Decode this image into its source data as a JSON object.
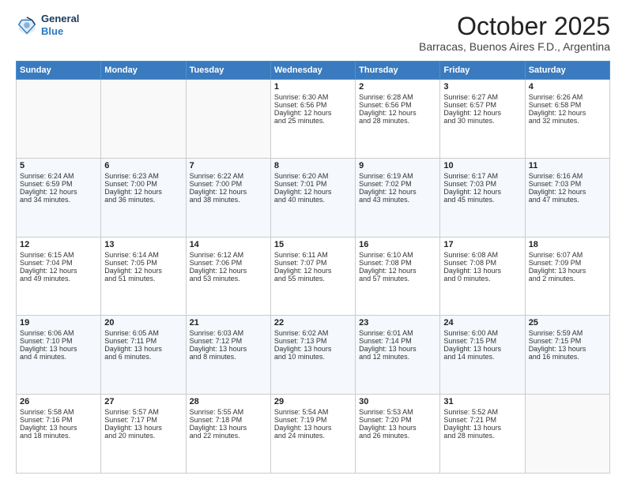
{
  "header": {
    "logo_line1": "General",
    "logo_line2": "Blue",
    "month": "October 2025",
    "location": "Barracas, Buenos Aires F.D., Argentina"
  },
  "days_of_week": [
    "Sunday",
    "Monday",
    "Tuesday",
    "Wednesday",
    "Thursday",
    "Friday",
    "Saturday"
  ],
  "weeks": [
    [
      {
        "day": "",
        "info": ""
      },
      {
        "day": "",
        "info": ""
      },
      {
        "day": "",
        "info": ""
      },
      {
        "day": "1",
        "info": "Sunrise: 6:30 AM\nSunset: 6:56 PM\nDaylight: 12 hours\nand 25 minutes."
      },
      {
        "day": "2",
        "info": "Sunrise: 6:28 AM\nSunset: 6:56 PM\nDaylight: 12 hours\nand 28 minutes."
      },
      {
        "day": "3",
        "info": "Sunrise: 6:27 AM\nSunset: 6:57 PM\nDaylight: 12 hours\nand 30 minutes."
      },
      {
        "day": "4",
        "info": "Sunrise: 6:26 AM\nSunset: 6:58 PM\nDaylight: 12 hours\nand 32 minutes."
      }
    ],
    [
      {
        "day": "5",
        "info": "Sunrise: 6:24 AM\nSunset: 6:59 PM\nDaylight: 12 hours\nand 34 minutes."
      },
      {
        "day": "6",
        "info": "Sunrise: 6:23 AM\nSunset: 7:00 PM\nDaylight: 12 hours\nand 36 minutes."
      },
      {
        "day": "7",
        "info": "Sunrise: 6:22 AM\nSunset: 7:00 PM\nDaylight: 12 hours\nand 38 minutes."
      },
      {
        "day": "8",
        "info": "Sunrise: 6:20 AM\nSunset: 7:01 PM\nDaylight: 12 hours\nand 40 minutes."
      },
      {
        "day": "9",
        "info": "Sunrise: 6:19 AM\nSunset: 7:02 PM\nDaylight: 12 hours\nand 43 minutes."
      },
      {
        "day": "10",
        "info": "Sunrise: 6:17 AM\nSunset: 7:03 PM\nDaylight: 12 hours\nand 45 minutes."
      },
      {
        "day": "11",
        "info": "Sunrise: 6:16 AM\nSunset: 7:03 PM\nDaylight: 12 hours\nand 47 minutes."
      }
    ],
    [
      {
        "day": "12",
        "info": "Sunrise: 6:15 AM\nSunset: 7:04 PM\nDaylight: 12 hours\nand 49 minutes."
      },
      {
        "day": "13",
        "info": "Sunrise: 6:14 AM\nSunset: 7:05 PM\nDaylight: 12 hours\nand 51 minutes."
      },
      {
        "day": "14",
        "info": "Sunrise: 6:12 AM\nSunset: 7:06 PM\nDaylight: 12 hours\nand 53 minutes."
      },
      {
        "day": "15",
        "info": "Sunrise: 6:11 AM\nSunset: 7:07 PM\nDaylight: 12 hours\nand 55 minutes."
      },
      {
        "day": "16",
        "info": "Sunrise: 6:10 AM\nSunset: 7:08 PM\nDaylight: 12 hours\nand 57 minutes."
      },
      {
        "day": "17",
        "info": "Sunrise: 6:08 AM\nSunset: 7:08 PM\nDaylight: 13 hours\nand 0 minutes."
      },
      {
        "day": "18",
        "info": "Sunrise: 6:07 AM\nSunset: 7:09 PM\nDaylight: 13 hours\nand 2 minutes."
      }
    ],
    [
      {
        "day": "19",
        "info": "Sunrise: 6:06 AM\nSunset: 7:10 PM\nDaylight: 13 hours\nand 4 minutes."
      },
      {
        "day": "20",
        "info": "Sunrise: 6:05 AM\nSunset: 7:11 PM\nDaylight: 13 hours\nand 6 minutes."
      },
      {
        "day": "21",
        "info": "Sunrise: 6:03 AM\nSunset: 7:12 PM\nDaylight: 13 hours\nand 8 minutes."
      },
      {
        "day": "22",
        "info": "Sunrise: 6:02 AM\nSunset: 7:13 PM\nDaylight: 13 hours\nand 10 minutes."
      },
      {
        "day": "23",
        "info": "Sunrise: 6:01 AM\nSunset: 7:14 PM\nDaylight: 13 hours\nand 12 minutes."
      },
      {
        "day": "24",
        "info": "Sunrise: 6:00 AM\nSunset: 7:15 PM\nDaylight: 13 hours\nand 14 minutes."
      },
      {
        "day": "25",
        "info": "Sunrise: 5:59 AM\nSunset: 7:15 PM\nDaylight: 13 hours\nand 16 minutes."
      }
    ],
    [
      {
        "day": "26",
        "info": "Sunrise: 5:58 AM\nSunset: 7:16 PM\nDaylight: 13 hours\nand 18 minutes."
      },
      {
        "day": "27",
        "info": "Sunrise: 5:57 AM\nSunset: 7:17 PM\nDaylight: 13 hours\nand 20 minutes."
      },
      {
        "day": "28",
        "info": "Sunrise: 5:55 AM\nSunset: 7:18 PM\nDaylight: 13 hours\nand 22 minutes."
      },
      {
        "day": "29",
        "info": "Sunrise: 5:54 AM\nSunset: 7:19 PM\nDaylight: 13 hours\nand 24 minutes."
      },
      {
        "day": "30",
        "info": "Sunrise: 5:53 AM\nSunset: 7:20 PM\nDaylight: 13 hours\nand 26 minutes."
      },
      {
        "day": "31",
        "info": "Sunrise: 5:52 AM\nSunset: 7:21 PM\nDaylight: 13 hours\nand 28 minutes."
      },
      {
        "day": "",
        "info": ""
      }
    ]
  ]
}
